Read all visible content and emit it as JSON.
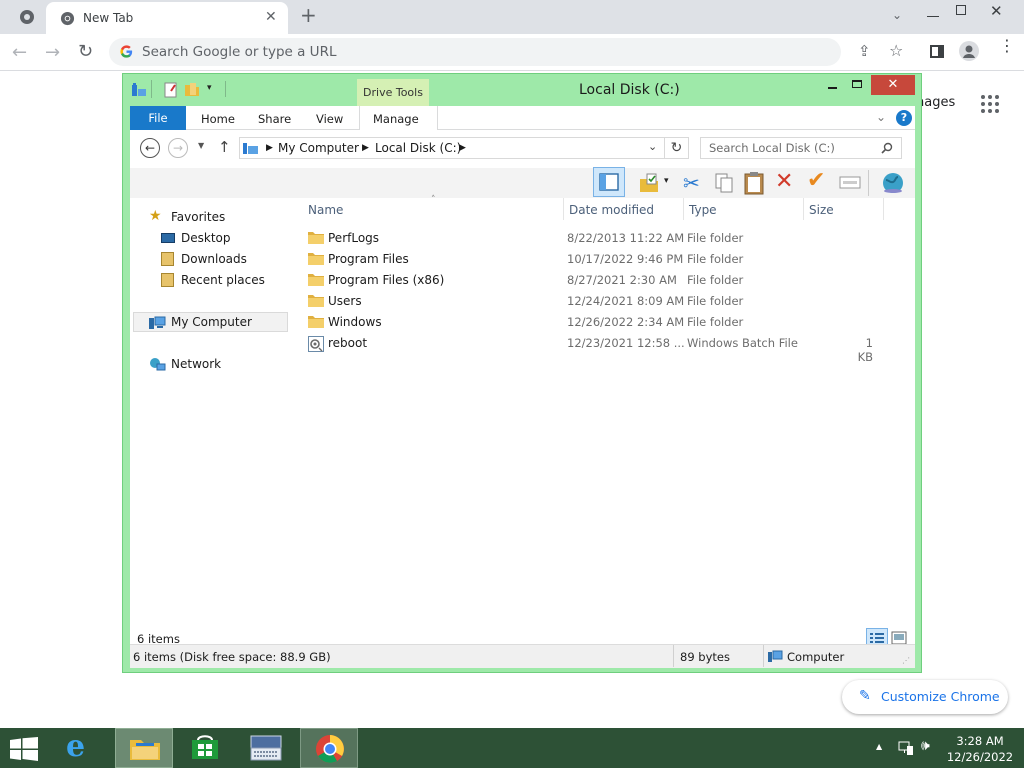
{
  "browser": {
    "tab_title": "New Tab",
    "omnibox_placeholder": "Search Google or type a URL",
    "images_link_partial": "nages",
    "customize_label": "Customize Chrome"
  },
  "explorer": {
    "window_title": "Local Disk (C:)",
    "contextual_tab_group": "Drive Tools",
    "ribbon_tabs": [
      "File",
      "Home",
      "Share",
      "View",
      "Manage"
    ],
    "breadcrumb": [
      "My Computer",
      "Local Disk (C:)"
    ],
    "search_placeholder": "Search Local Disk (C:)",
    "nav": {
      "favorites": "Favorites",
      "desktop": "Desktop",
      "downloads": "Downloads",
      "recent": "Recent places",
      "computer": "My Computer",
      "network": "Network"
    },
    "columns": [
      "Name",
      "Date modified",
      "Type",
      "Size"
    ],
    "files": [
      {
        "name": "PerfLogs",
        "date": "8/22/2013 11:22 AM",
        "type": "File folder",
        "size": "",
        "icon": "folder-icon"
      },
      {
        "name": "Program Files",
        "date": "10/17/2022 9:46 PM",
        "type": "File folder",
        "size": "",
        "icon": "folder-icon"
      },
      {
        "name": "Program Files (x86)",
        "date": "8/27/2021 2:30 AM",
        "type": "File folder",
        "size": "",
        "icon": "folder-icon"
      },
      {
        "name": "Users",
        "date": "12/24/2021 8:09 AM",
        "type": "File folder",
        "size": "",
        "icon": "folder-icon"
      },
      {
        "name": "Windows",
        "date": "12/26/2022 2:34 AM",
        "type": "File folder",
        "size": "",
        "icon": "folder-icon"
      },
      {
        "name": "reboot",
        "date": "12/23/2021 12:58 ...",
        "type": "Windows Batch File",
        "size": "1 KB",
        "icon": "batch-file-icon"
      }
    ],
    "item_count": "6 items",
    "status_left": "6 items (Disk free space: 88.9 GB)",
    "status_size": "89 bytes",
    "status_location": "Computer"
  },
  "taskbar": {
    "time": "3:28 AM",
    "date": "12/26/2022"
  },
  "colors": {
    "window_frame": "#9ee9a9",
    "file_tab": "#1979ca",
    "taskbar": "#2d5136",
    "close_button": "#c7483b"
  }
}
